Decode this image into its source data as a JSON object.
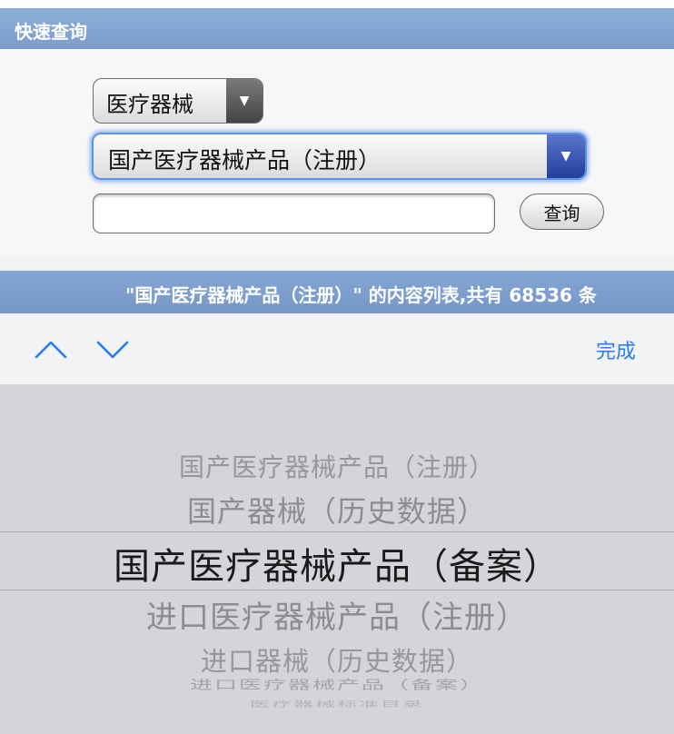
{
  "header": {
    "title": "快速查询"
  },
  "form": {
    "category_select": "医疗器械",
    "type_select": "国产医疗器械产品（注册）",
    "query_input_value": "",
    "query_button": "查询"
  },
  "result": {
    "summary": "\"国产医疗器械产品（注册）\" 的内容列表,共有 68536 条"
  },
  "toolbar": {
    "prev_icon": "chevron-up-icon",
    "next_icon": "chevron-down-icon",
    "done_label": "完成",
    "accent_color": "#2a7cf6"
  },
  "picker": {
    "options": [
      "国产医疗器械产品（注册）",
      "国产器械（历史数据）",
      "国产医疗器械产品（备案）",
      "进口医疗器械产品（注册）",
      "进口器械（历史数据）",
      "进口医疗器械产品（备案）",
      "医疗器械标准目录"
    ],
    "selected": "国产医疗器械产品（备案）"
  }
}
